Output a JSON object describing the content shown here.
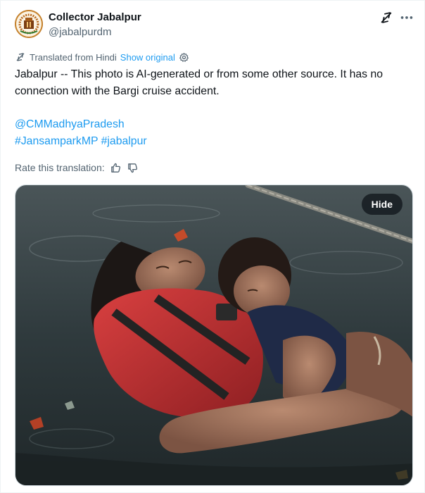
{
  "author": {
    "name": "Collector Jabalpur",
    "handle": "@jabalpurdm",
    "avatar_icon": "emblem-logo"
  },
  "header_icons": [
    "grok-icon",
    "more-horizontal-icon"
  ],
  "translation": {
    "label": "Translated from Hindi",
    "show_original": "Show original",
    "icon": "translate-icon",
    "settings_icon": "gear-icon"
  },
  "body": {
    "text": "Jabalpur -- This photo is AI-generated or from some other source. It has no connection with the Bargi cruise accident.",
    "mention": "@CMMadhyaPradesh",
    "hashtag_1": "#JansamparkMP",
    "hashtag_2": "#jabalpur"
  },
  "rate": {
    "label": "Rate this translation:",
    "like_icon": "thumbs-up-icon",
    "dislike_icon": "thumbs-down-icon"
  },
  "media": {
    "hide_label": "Hide",
    "description_icon": "photo"
  },
  "colors": {
    "link": "#1d9bf0",
    "secondary_text": "#536471",
    "primary_text": "#0f1419",
    "life_jacket": "#c62f2f"
  }
}
